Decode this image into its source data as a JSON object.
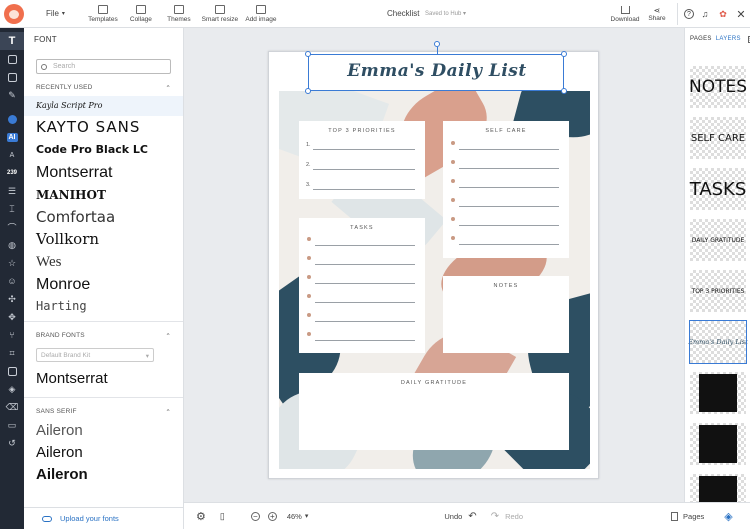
{
  "topbar": {
    "file_label": "File",
    "tools": [
      {
        "label": "Templates",
        "icon": "templates-icon"
      },
      {
        "label": "Collage",
        "icon": "collage-icon"
      },
      {
        "label": "Themes",
        "icon": "themes-icon"
      },
      {
        "label": "Smart resize",
        "icon": "smart-resize-icon"
      },
      {
        "label": "Add image",
        "icon": "add-image-icon"
      }
    ],
    "doc_title": "Checklist",
    "saved_status": "Saved to Hub",
    "download_label": "Download",
    "share_label": "Share"
  },
  "left_panel": {
    "title": "FONT",
    "search_placeholder": "Search",
    "recently_used_label": "RECENTLY USED",
    "recent_fonts": [
      "Kayla Script Pro",
      "KAYTO SANS",
      "Code Pro Black LC",
      "Montserrat",
      "MANIHOT",
      "Comfortaa",
      "Vollkorn",
      "Wes",
      "Monroe",
      "Harting"
    ],
    "brand_fonts_label": "BRAND FONTS",
    "brand_kit_select": "Default Brand Kit",
    "brand_fonts": [
      "Montserrat"
    ],
    "sans_serif_label": "SANS SERIF",
    "sans_fonts": [
      "Aileron",
      "Aileron",
      "Aileron"
    ],
    "upload_label": "Upload your fonts"
  },
  "left_rail": {
    "badge_ai": "AI",
    "badge_num": "239"
  },
  "canvas": {
    "title": "Emma's Daily List",
    "boxes": {
      "priorities": "TOP 3 PRIORITIES",
      "self_care": "SELF CARE",
      "tasks": "TASKS",
      "notes": "NOTES",
      "gratitude": "DAILY GRATITUDE"
    },
    "priority_numbers": [
      "1.",
      "2.",
      "3."
    ]
  },
  "bottombar": {
    "zoom": "46%",
    "undo_label": "Undo",
    "redo_label": "Redo",
    "pages_label": "Pages"
  },
  "right_panel": {
    "tab_pages": "PAGES",
    "tab_layers": "LAYERS",
    "layers": [
      "NOTES",
      "SELF CARE",
      "TASKS",
      "DAILY GRATITUDE",
      "TOP 3 PRIORITIES",
      "Emma's Daily List",
      "",
      "",
      ""
    ]
  },
  "colors": {
    "accent": "#3a7bd5",
    "rail_bg": "#222935",
    "title_color": "#2f4e63",
    "bullet_color": "#c99a84"
  }
}
